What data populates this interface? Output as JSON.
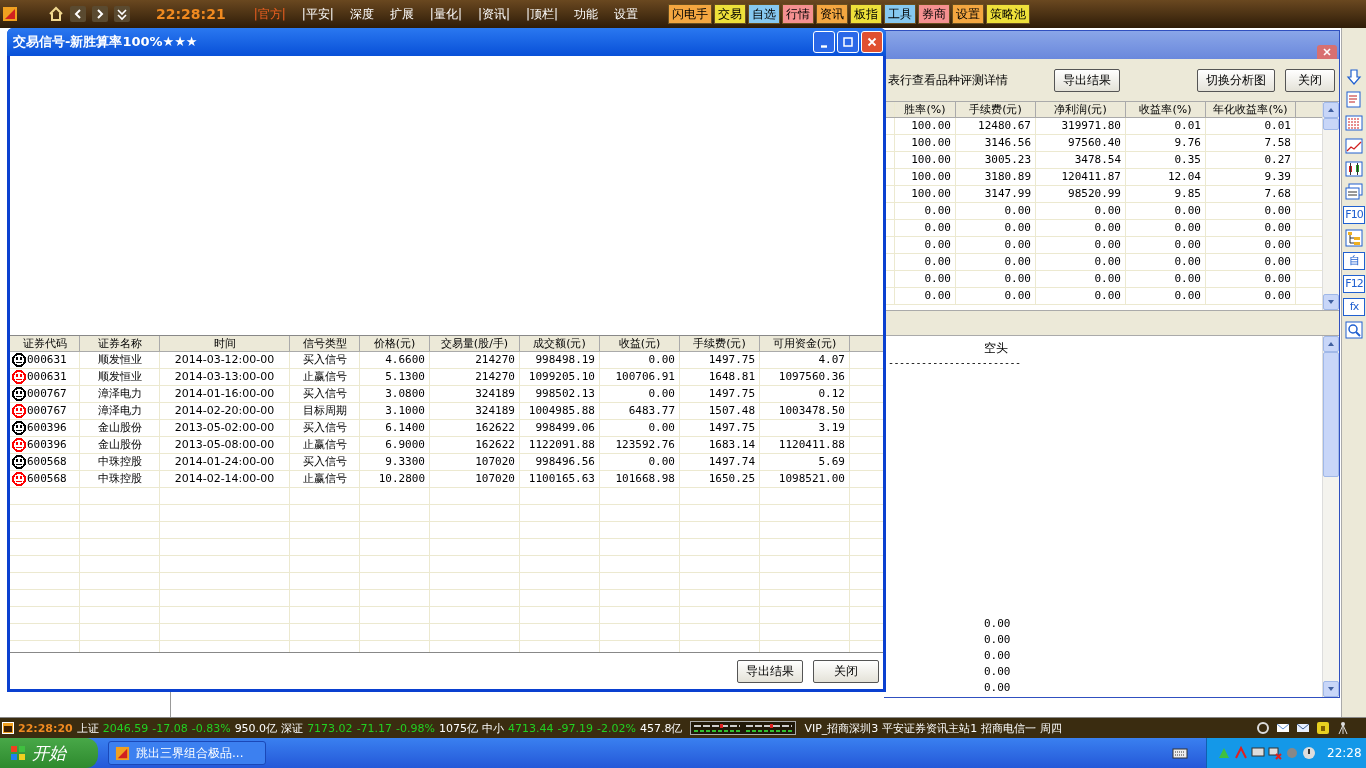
{
  "top_bar": {
    "time": "22:28:21",
    "menus": [
      {
        "label": "|官方|",
        "selected": true
      },
      {
        "label": "|平安|",
        "selected": false
      },
      {
        "label": "深度",
        "selected": false
      },
      {
        "label": "扩展",
        "selected": false
      },
      {
        "label": "|量化|",
        "selected": false
      },
      {
        "label": "|资讯|",
        "selected": false
      },
      {
        "label": "|顶栏|",
        "selected": false
      },
      {
        "label": "功能",
        "selected": false
      },
      {
        "label": "设置",
        "selected": false
      }
    ],
    "quick_buttons": [
      {
        "label": "闪电手",
        "color": "#f4a640"
      },
      {
        "label": "交易",
        "color": "#eee03a"
      },
      {
        "label": "自选",
        "color": "#86c8f0"
      },
      {
        "label": "行情",
        "color": "#f59090"
      },
      {
        "label": "资讯",
        "color": "#f4a640"
      },
      {
        "label": "板指",
        "color": "#eee03a"
      },
      {
        "label": "工具",
        "color": "#86c8f0"
      },
      {
        "label": "券商",
        "color": "#f59090"
      },
      {
        "label": "设置",
        "color": "#f4a640"
      },
      {
        "label": "策略池",
        "color": "#eee03a"
      }
    ]
  },
  "dialog": {
    "title": "交易信号-新胜算率100%★★★",
    "columns": [
      "证券代码",
      "证券名称",
      "时间",
      "信号类型",
      "价格(元)",
      "交易量(股/手)",
      "成交额(元)",
      "收益(元)",
      "手续费(元)",
      "可用资金(元)"
    ],
    "rows": [
      {
        "color": "#000000",
        "cells": [
          "000631",
          "顺发恒业",
          "2014-03-12:00-00",
          "买入信号",
          "4.6600",
          "214270",
          "998498.19",
          "0.00",
          "1497.75",
          "4.07"
        ]
      },
      {
        "color": "#ff0000",
        "cells": [
          "000631",
          "顺发恒业",
          "2014-03-13:00-00",
          "止赢信号",
          "5.1300",
          "214270",
          "1099205.10",
          "100706.91",
          "1648.81",
          "1097560.36"
        ]
      },
      {
        "color": "#000000",
        "cells": [
          "000767",
          "漳泽电力",
          "2014-01-16:00-00",
          "买入信号",
          "3.0800",
          "324189",
          "998502.13",
          "0.00",
          "1497.75",
          "0.12"
        ]
      },
      {
        "color": "#ff0000",
        "cells": [
          "000767",
          "漳泽电力",
          "2014-02-20:00-00",
          "目标周期",
          "3.1000",
          "324189",
          "1004985.88",
          "6483.77",
          "1507.48",
          "1003478.50"
        ]
      },
      {
        "color": "#000000",
        "cells": [
          "600396",
          "金山股份",
          "2013-05-02:00-00",
          "买入信号",
          "6.1400",
          "162622",
          "998499.06",
          "0.00",
          "1497.75",
          "3.19"
        ]
      },
      {
        "color": "#ff0000",
        "cells": [
          "600396",
          "金山股份",
          "2013-05-08:00-00",
          "止赢信号",
          "6.9000",
          "162622",
          "1122091.88",
          "123592.76",
          "1683.14",
          "1120411.88"
        ]
      },
      {
        "color": "#000000",
        "cells": [
          "600568",
          "中珠控股",
          "2014-01-24:00-00",
          "买入信号",
          "9.3300",
          "107020",
          "998496.56",
          "0.00",
          "1497.74",
          "5.69"
        ]
      },
      {
        "color": "#ff0000",
        "cells": [
          "600568",
          "中珠控股",
          "2014-02-14:00-00",
          "止赢信号",
          "10.2800",
          "107020",
          "1100165.63",
          "101668.98",
          "1650.25",
          "1098521.00"
        ]
      }
    ],
    "buttons": [
      "导出结果",
      "关闭"
    ]
  },
  "background_window": {
    "hint": "表行查看品种评测详情",
    "buttons": [
      "导出结果",
      "切换分析图",
      "关闭"
    ],
    "columns": [
      "胜率(%)",
      "手续费(元)",
      "净利润(元)",
      "收益率(%)",
      "年化收益率(%)"
    ],
    "rows": [
      [
        "100.00",
        "12480.67",
        "319971.80",
        "0.01",
        "0.01"
      ],
      [
        "100.00",
        "3146.56",
        "97560.40",
        "9.76",
        "7.58"
      ],
      [
        "100.00",
        "3005.23",
        "3478.54",
        "0.35",
        "0.27"
      ],
      [
        "100.00",
        "3180.89",
        "120411.87",
        "12.04",
        "9.39"
      ],
      [
        "100.00",
        "3147.99",
        "98520.99",
        "9.85",
        "7.68"
      ],
      [
        "0.00",
        "0.00",
        "0.00",
        "0.00",
        "0.00"
      ],
      [
        "0.00",
        "0.00",
        "0.00",
        "0.00",
        "0.00"
      ],
      [
        "0.00",
        "0.00",
        "0.00",
        "0.00",
        "0.00"
      ],
      [
        "0.00",
        "0.00",
        "0.00",
        "0.00",
        "0.00"
      ],
      [
        "0.00",
        "0.00",
        "0.00",
        "0.00",
        "0.00"
      ],
      [
        "0.00",
        "0.00",
        "0.00",
        "0.00",
        "0.00"
      ]
    ],
    "panel": {
      "heading": "空头",
      "rule": "------------------------",
      "values": [
        "0.00",
        "0.00",
        "0.00",
        "0.00",
        "0.00"
      ]
    }
  },
  "right_toolbar": [
    {
      "kind": "arrow-down"
    },
    {
      "kind": "list"
    },
    {
      "kind": "grid"
    },
    {
      "kind": "line"
    },
    {
      "kind": "candle"
    },
    {
      "kind": "windows"
    },
    {
      "kind": "text",
      "label": "F10"
    },
    {
      "kind": "tree"
    },
    {
      "kind": "text",
      "label": "自"
    },
    {
      "kind": "text",
      "label": "F12"
    },
    {
      "kind": "text",
      "label": "fx"
    },
    {
      "kind": "search"
    }
  ],
  "status_bar": {
    "time": "22:28:20",
    "indices": [
      {
        "name": "上证",
        "value": "2046.59",
        "change": "-17.08",
        "percent": "-0.83%",
        "amount": "950.0亿"
      },
      {
        "name": "深证",
        "value": "7173.02",
        "change": "-71.17",
        "percent": "-0.98%",
        "amount": "1075亿"
      },
      {
        "name": "中小",
        "value": "4713.44",
        "change": "-97.19",
        "percent": "-2.02%",
        "amount": "457.8亿"
      }
    ],
    "servers": [
      "VIP_招商深圳3",
      "平安证券资讯主站1",
      "招商电信一"
    ],
    "weekday": "周四"
  },
  "taskbar": {
    "start": "开始",
    "tasks": [
      {
        "label": "跳出三界组合极品...",
        "selected": false
      }
    ],
    "clock": "22:28"
  }
}
